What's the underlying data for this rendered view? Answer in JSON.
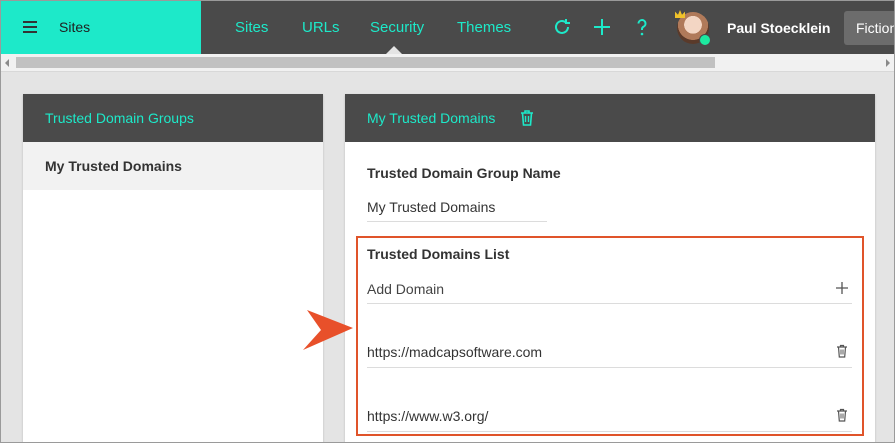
{
  "brand": {
    "label": "Sites",
    "menu_icon": "hamburger-menu-icon"
  },
  "nav": [
    {
      "label": "Sites",
      "active": false
    },
    {
      "label": "URLs",
      "active": false
    },
    {
      "label": "Security",
      "active": true
    },
    {
      "label": "Themes",
      "active": false
    }
  ],
  "toolbar": {
    "refresh_icon": "refresh-icon",
    "add_icon": "plus-icon",
    "help_icon": "help-icon"
  },
  "user": {
    "name": "Paul Stoecklein",
    "status": "online"
  },
  "account_button": {
    "label": "Fiction"
  },
  "left_panel": {
    "title": "Trusted Domain Groups",
    "items": [
      {
        "label": "My Trusted Domains",
        "selected": true
      }
    ]
  },
  "right_panel": {
    "title": "My Trusted Domains",
    "delete_icon": "trash-icon",
    "group_name_label": "Trusted Domain Group Name",
    "group_name_value": "My Trusted Domains",
    "domains_list_label": "Trusted Domains List",
    "add_domain_placeholder": "Add Domain",
    "domains": [
      "https://madcapsoftware.com",
      "https://www.w3.org/"
    ]
  },
  "colors": {
    "accent": "#1de9c9",
    "header_bg": "#4a4a4a",
    "highlight_box": "#e0542a",
    "callout_arrow": "#e8502a"
  }
}
